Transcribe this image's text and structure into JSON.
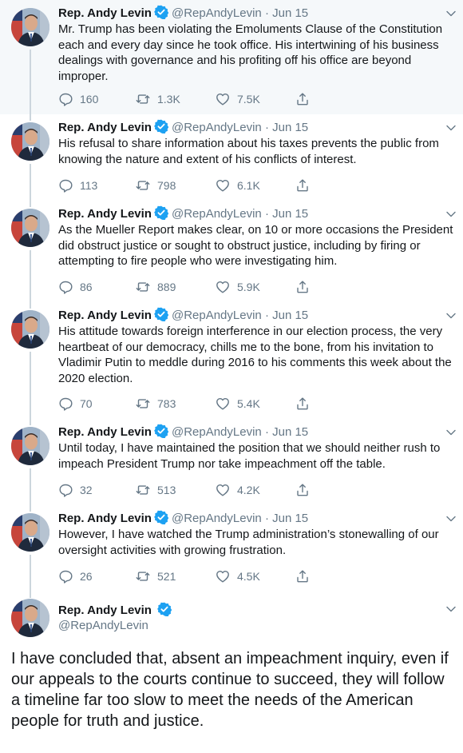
{
  "author": {
    "name": "Rep. Andy Levin",
    "handle": "@RepAndyLevin",
    "separator": "·"
  },
  "colors": {
    "verified": "#1da1f2",
    "muted": "#657786",
    "thread_line": "#ccd6dd",
    "highlight_bg": "#f5f8fa"
  },
  "icons": {
    "reply": "reply-icon",
    "retweet": "retweet-icon",
    "like": "like-icon",
    "share": "share-icon",
    "verified": "verified-badge-icon",
    "caret": "chevron-down-icon"
  },
  "tweets": [
    {
      "date": "Jun 15",
      "text": "Mr. Trump has been violating the Emoluments Clause of the Constitution each and every day since he took office. His intertwining of his business dealings with governance and his profiting off his office are beyond improper.",
      "replies": "160",
      "retweets": "1.3K",
      "likes": "7.5K"
    },
    {
      "date": "Jun 15",
      "text": "His refusal to share information about his taxes prevents the public from knowing the nature and extent of his conflicts of interest.",
      "replies": "113",
      "retweets": "798",
      "likes": "6.1K"
    },
    {
      "date": "Jun 15",
      "text": "As the Mueller Report makes clear, on 10 or more occasions the President did obstruct justice or sought to obstruct justice, including by firing or attempting to fire people who were investigating him.",
      "replies": "86",
      "retweets": "889",
      "likes": "5.9K"
    },
    {
      "date": "Jun 15",
      "text": "His attitude towards foreign interference in our election process, the very heartbeat of our democracy, chills me to the bone, from his invitation to Vladimir Putin to meddle during 2016 to his comments this week about the 2020 election.",
      "replies": "70",
      "retweets": "783",
      "likes": "5.4K"
    },
    {
      "date": "Jun 15",
      "text": "Until today, I have maintained the position that we should neither rush to impeach President Trump nor take impeachment off the table.",
      "replies": "32",
      "retweets": "513",
      "likes": "4.2K"
    },
    {
      "date": "Jun 15",
      "text": "However, I have watched the Trump administration’s stonewalling of our oversight activities with growing frustration.",
      "replies": "26",
      "retweets": "521",
      "likes": "4.5K"
    }
  ],
  "focused_tweet": {
    "text": "I have concluded that, absent an impeachment inquiry, even if our appeals to the courts continue to succeed, they will follow a timeline far too slow to meet the needs of the American people for truth and justice."
  }
}
